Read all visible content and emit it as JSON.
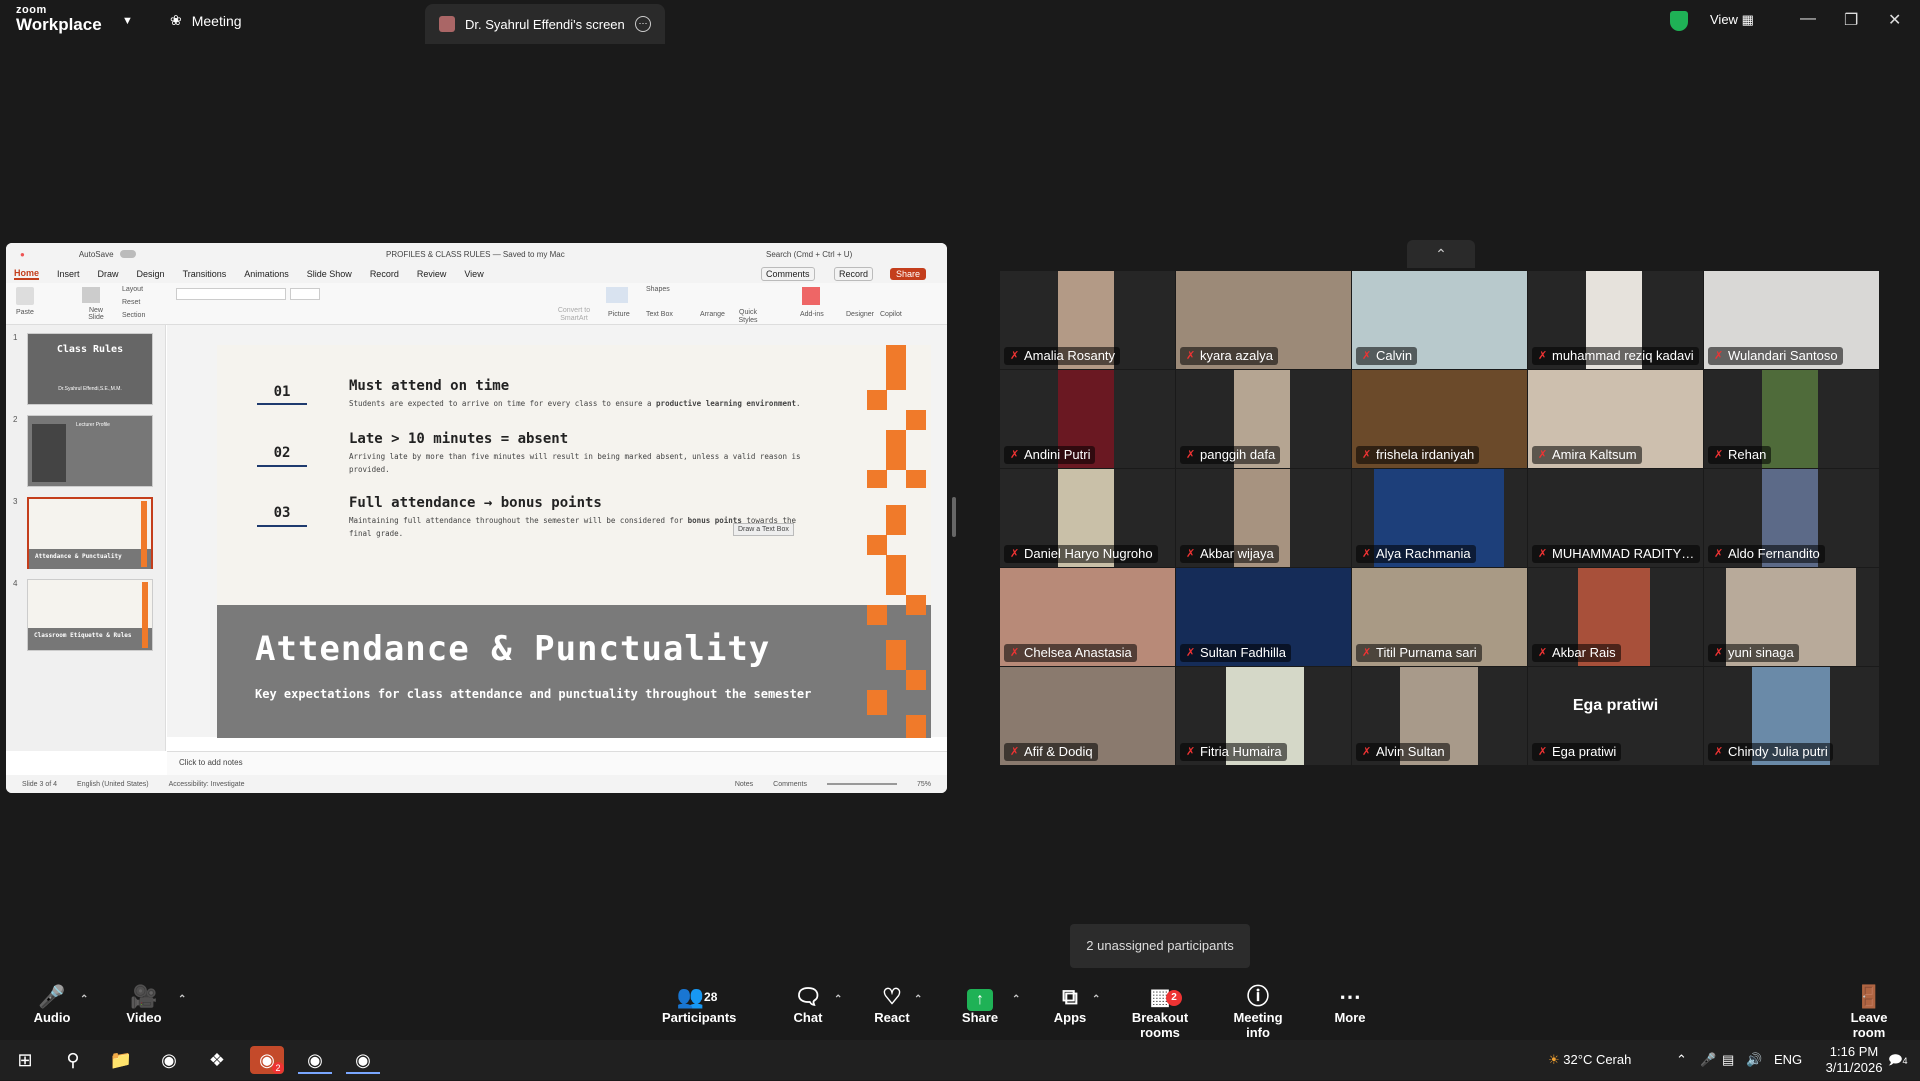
{
  "titlebar": {
    "app_brand_top": "zoom",
    "app_brand_bottom": "Workplace",
    "meeting_tab": "Meeting",
    "screen_tab": "Dr. Syahrul Effendi's screen",
    "view_label": "View"
  },
  "ppt": {
    "autosave": "AutoSave",
    "doc_title": "PROFILES & CLASS RULES — Saved to my Mac",
    "search": "Search (Cmd + Ctrl + U)",
    "menu": [
      "Home",
      "Insert",
      "Draw",
      "Design",
      "Transitions",
      "Animations",
      "Slide Show",
      "Record",
      "Review",
      "View"
    ],
    "comments_btn": "Comments",
    "record_btn": "Record",
    "share_btn": "Share",
    "ribbon": {
      "paste": "Paste",
      "new_slide": "New Slide",
      "layout": "Layout",
      "reset": "Reset",
      "section": "Section",
      "convert": "Convert to SmartArt",
      "picture": "Picture",
      "shapes": "Shapes",
      "textbox": "Text Box",
      "arrange": "Arrange",
      "quick_styles": "Quick Styles",
      "addins": "Add-ins",
      "designer": "Designer",
      "copilot": "Copilot"
    },
    "thumbnails": [
      {
        "num": "1",
        "title": "Class Rules",
        "sub": "Dr.Syahrul Effendi,S.E.,M.M."
      },
      {
        "num": "2",
        "title": "Lecturer Profile",
        "sub": ""
      },
      {
        "num": "3",
        "title": "Attendance & Punctuality",
        "sub": ""
      },
      {
        "num": "4",
        "title": "Classroom Etiquette & Rules",
        "sub": ""
      }
    ],
    "slide": {
      "items": [
        {
          "num": "01",
          "title": "Must attend on time",
          "desc_pre": "Students are expected to arrive on time for every class to ensure a ",
          "desc_bold": "productive learning environment",
          "desc_post": "."
        },
        {
          "num": "02",
          "title": "Late > 10 minutes = absent",
          "desc_pre": "Arriving late by more than five minutes will result in being marked absent, unless a valid reason is provided.",
          "desc_bold": "",
          "desc_post": ""
        },
        {
          "num": "03",
          "title": "Full attendance → bonus points",
          "desc_pre": "Maintaining full attendance throughout the semester will be considered for ",
          "desc_bold": "bonus points",
          "desc_post": " towards the final grade."
        }
      ],
      "heading": "Attendance & Punctuality",
      "subheading": "Key expectations for class attendance and punctuality throughout the semester",
      "draw_textbox": "Draw a Text Box"
    },
    "notes_placeholder": "Click to add notes",
    "status": {
      "slide_count": "Slide 3 of 4",
      "language": "English (United States)",
      "accessibility": "Accessibility: Investigate",
      "notes": "Notes",
      "comments": "Comments",
      "zoom": "75%"
    }
  },
  "participants_grid": [
    [
      "Amalia Rosanty",
      "kyara azalya",
      "Calvin",
      "muhammad reziq kadavi",
      "Wulandari Santoso"
    ],
    [
      "Andini Putri",
      "panggih dafa",
      "frishela irdaniyah",
      "Amira Kaltsum",
      "Rehan"
    ],
    [
      "Daniel Haryo Nugroho",
      "Akbar wijaya",
      "Alya Rachmania",
      "MUHAMMAD RADITYIA ...",
      "Aldo Fernandito"
    ],
    [
      "Chelsea Anastasia",
      "Sultan Fadhilla",
      "Titil Purnama sari",
      "Akbar Rais",
      "yuni sinaga"
    ],
    [
      "Afif & Dodiq",
      "Fitria Humaira",
      "Alvin Sultan",
      "Ega pratiwi",
      "Chindy Julia putri"
    ]
  ],
  "ega_big_name": "Ega pratiwi",
  "toast": "2 unassigned participants",
  "toolbar": {
    "audio": "Audio",
    "video": "Video",
    "participants": "Participants",
    "participants_count": "28",
    "chat": "Chat",
    "react": "React",
    "share": "Share",
    "apps": "Apps",
    "breakout": "Breakout rooms",
    "breakout_badge": "2",
    "meeting_info": "Meeting info",
    "more": "More",
    "leave": "Leave room"
  },
  "taskbar": {
    "weather": "32°C  Cerah",
    "lang": "ENG",
    "time": "1:16 PM",
    "date": "3/11/2026",
    "notif_count": "4",
    "zoom_badge": "2"
  },
  "colors": {
    "accent_orange": "#f07a2a",
    "ppt_red": "#c43e1c",
    "zoom_green": "#1fb256",
    "muted_red": "#e33333"
  }
}
